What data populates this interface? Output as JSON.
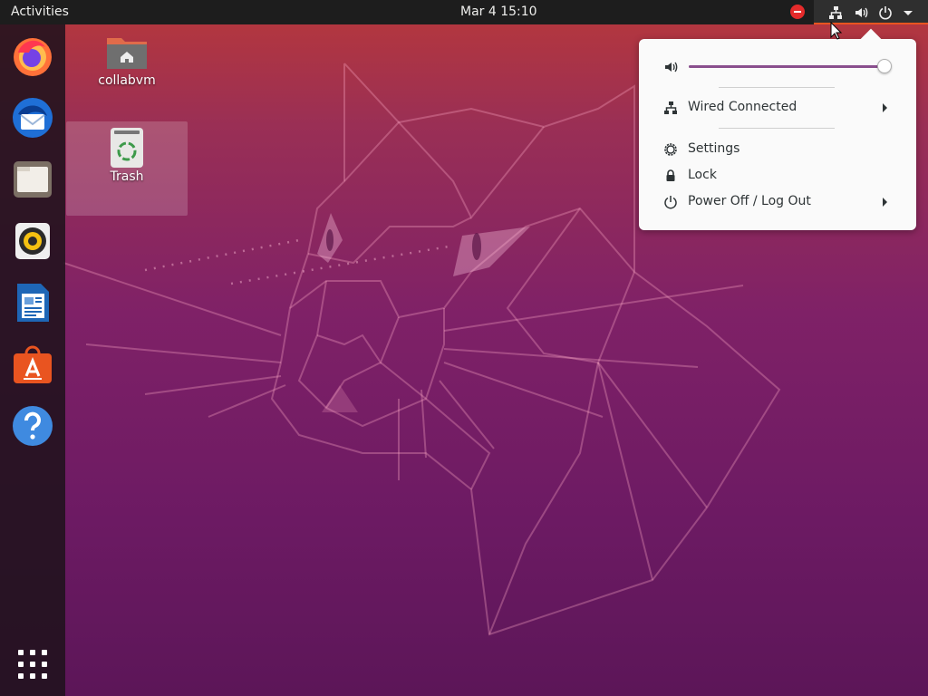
{
  "topbar": {
    "activities_label": "Activities",
    "clock": "Mar 4  15:10",
    "tray_icons": [
      "do-not-disturb-icon",
      "network-wired-icon",
      "volume-icon",
      "power-icon",
      "menu-arrow-icon"
    ]
  },
  "dock": {
    "items": [
      {
        "name": "firefox",
        "icon": "firefox-icon"
      },
      {
        "name": "thunderbird",
        "icon": "thunderbird-icon"
      },
      {
        "name": "files",
        "icon": "files-icon"
      },
      {
        "name": "rhythmbox",
        "icon": "rhythmbox-icon"
      },
      {
        "name": "writer",
        "icon": "libreoffice-writer-icon"
      },
      {
        "name": "software",
        "icon": "ubuntu-software-icon"
      },
      {
        "name": "help",
        "icon": "help-icon"
      }
    ],
    "show_apps_icon": "app-grid-icon"
  },
  "desktop": {
    "icons": [
      {
        "label": "collabvm",
        "icon": "home-folder-icon"
      },
      {
        "label": "Trash",
        "icon": "trash-icon",
        "selected": true
      }
    ]
  },
  "system_menu": {
    "volume": {
      "icon": "volume-icon",
      "level_percent": 100
    },
    "items": [
      {
        "label": "Wired Connected",
        "icon": "network-wired-icon",
        "submenu": true
      },
      {
        "label": "Settings",
        "icon": "settings-icon",
        "submenu": false
      },
      {
        "label": "Lock",
        "icon": "lock-icon",
        "submenu": false
      },
      {
        "label": "Power Off / Log Out",
        "icon": "power-icon",
        "submenu": true
      }
    ]
  },
  "colors": {
    "accent": "#e95420",
    "slider_fill": "#8a4f8e",
    "topbar": "#1d1d1d"
  }
}
